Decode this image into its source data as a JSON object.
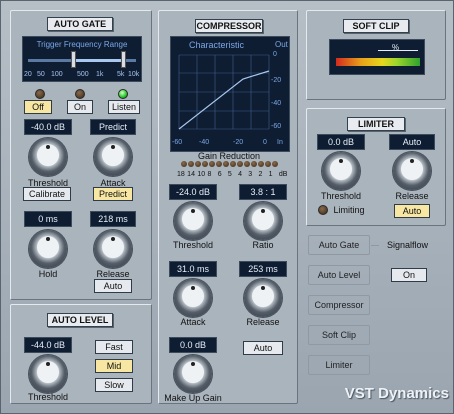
{
  "plugin": {
    "brand": "VST Dynamics"
  },
  "autogate": {
    "title": "AUTO GATE",
    "trigger_label": "Trigger Frequency Range",
    "freq_ticks": [
      "20",
      "50",
      "100",
      "500",
      "1k",
      "5k",
      "10k"
    ],
    "buttons": {
      "off": "Off",
      "on": "On",
      "listen": "Listen"
    },
    "threshold": {
      "value": "-40.0 dB",
      "label": "Threshold",
      "button": "Calibrate"
    },
    "attack": {
      "value": "Predict",
      "label": "Attack",
      "button": "Predict"
    },
    "hold": {
      "value": "0 ms",
      "label": "Hold"
    },
    "release": {
      "value": "218 ms",
      "label": "Release",
      "button": "Auto"
    }
  },
  "compressor": {
    "title": "COMPRESSOR",
    "graph_title": "Characteristic",
    "graph_out": "Out",
    "y_ticks": [
      "0",
      "-20",
      "-40",
      "-60"
    ],
    "x_ticks": [
      "-60",
      "-40",
      "-20",
      "0",
      "In"
    ],
    "gr_title": "Gain Reduction",
    "gr_scale": [
      "18",
      "14",
      "10",
      "8",
      "6",
      "5",
      "4",
      "3",
      "2",
      "1",
      "dB"
    ],
    "threshold": {
      "value": "-24.0 dB",
      "label": "Threshold"
    },
    "ratio": {
      "value": "3.8 : 1",
      "label": "Ratio"
    },
    "attack": {
      "value": "31.0 ms",
      "label": "Attack"
    },
    "release": {
      "value": "253 ms",
      "label": "Release",
      "button": "Auto"
    },
    "makeup": {
      "value": "0.0 dB",
      "label": "Make Up Gain"
    }
  },
  "softclip": {
    "title": "SOFT CLIP",
    "meter_label": "%"
  },
  "limiter": {
    "title": "LIMITER",
    "threshold": {
      "value": "0.0 dB",
      "label": "Threshold"
    },
    "release": {
      "value": "Auto",
      "label": "Release",
      "button": "Auto"
    },
    "limiting_label": "Limiting"
  },
  "autolevel": {
    "title": "AUTO LEVEL",
    "threshold": {
      "value": "-44.0 dB",
      "label": "Threshold"
    },
    "buttons": {
      "fast": "Fast",
      "mid": "Mid",
      "slow": "Slow"
    }
  },
  "signalflow": {
    "label": "Signalflow",
    "button": "On",
    "modules": [
      "Auto Gate",
      "Auto Level",
      "Compressor",
      "Soft Clip",
      "Limiter"
    ]
  },
  "colors": {
    "accent_on": "#f7e7a2",
    "lcd_bg": "#0f1d33",
    "panel": "#aab4bd",
    "led_green": "#2ecf2e"
  }
}
